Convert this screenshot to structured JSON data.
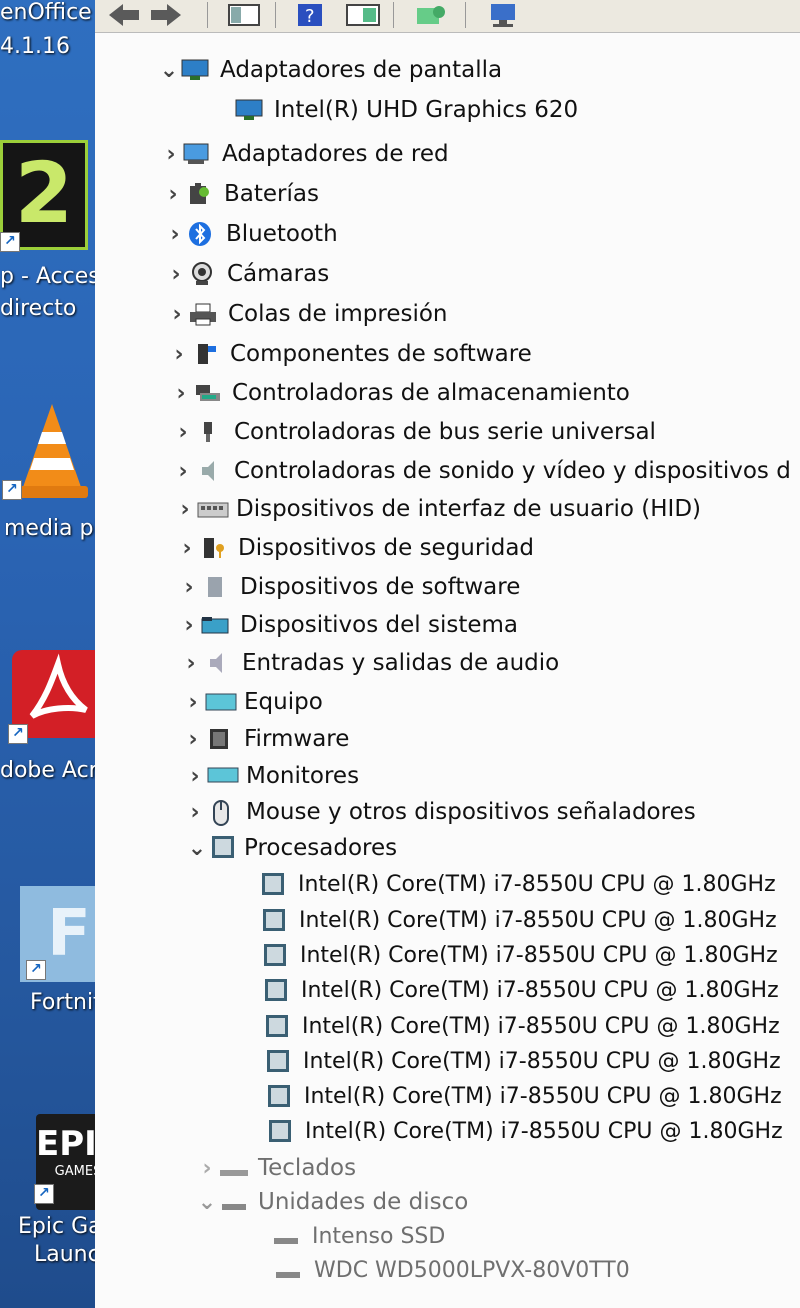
{
  "desktop": {
    "top_label_1": "enOffice",
    "top_label_2": "4.1.16",
    "icons": [
      {
        "label_1": "p - Acces",
        "label_2": "directo",
        "icon": "number-2-app-icon"
      },
      {
        "label_1": "media pla",
        "icon": "vlc-cone-icon"
      },
      {
        "label_1": "dobe Acrob",
        "icon": "acrobat-icon"
      },
      {
        "label_1": "Fortnite",
        "icon": "fortnite-icon",
        "glyph": "F"
      },
      {
        "label_1": "Epic Games",
        "label_2": "Launcher",
        "icon": "epic-games-icon",
        "logo_1": "EPIC",
        "logo_2": "GAMES"
      }
    ]
  },
  "toolbar": {
    "buttons": [
      "back-arrow-icon",
      "forward-arrow-icon",
      "show-hide-tree-icon",
      "help-icon",
      "properties-icon",
      "scan-hardware-icon",
      "monitor-icon"
    ]
  },
  "tree": {
    "display_adapters": {
      "label": "Adaptadores de pantalla",
      "expanded": true,
      "children": [
        "Intel(R) UHD Graphics 620"
      ]
    },
    "collapsed_categories": [
      "Adaptadores de red",
      "Baterías",
      "Bluetooth",
      "Cámaras",
      "Colas de impresión",
      "Componentes de software",
      "Controladoras de almacenamiento",
      "Controladoras de bus serie universal",
      "Controladoras de sonido y vídeo y dispositivos d",
      "Dispositivos de interfaz de usuario (HID)",
      "Dispositivos de seguridad",
      "Dispositivos de software",
      "Dispositivos del sistema",
      "Entradas y salidas de audio",
      "Equipo",
      "Firmware",
      "Monitores",
      "Mouse y otros dispositivos señaladores"
    ],
    "processors": {
      "label": "Procesadores",
      "expanded": true,
      "children": [
        "Intel(R) Core(TM) i7-8550U CPU @ 1.80GHz",
        "Intel(R) Core(TM) i7-8550U CPU @ 1.80GHz",
        "Intel(R) Core(TM) i7-8550U CPU @ 1.80GHz",
        "Intel(R) Core(TM) i7-8550U CPU @ 1.80GHz",
        "Intel(R) Core(TM) i7-8550U CPU @ 1.80GHz",
        "Intel(R) Core(TM) i7-8550U CPU @ 1.80GHz",
        "Intel(R) Core(TM) i7-8550U CPU @ 1.80GHz",
        "Intel(R) Core(TM) i7-8550U CPU @ 1.80GHz"
      ]
    },
    "keyboards": {
      "label": "Teclados",
      "expanded": false
    },
    "disk_drives": {
      "label": "Unidades de disco",
      "expanded": true,
      "children": [
        "Intenso SSD",
        "WDC WD5000LPVX-80V0TT0"
      ]
    }
  }
}
